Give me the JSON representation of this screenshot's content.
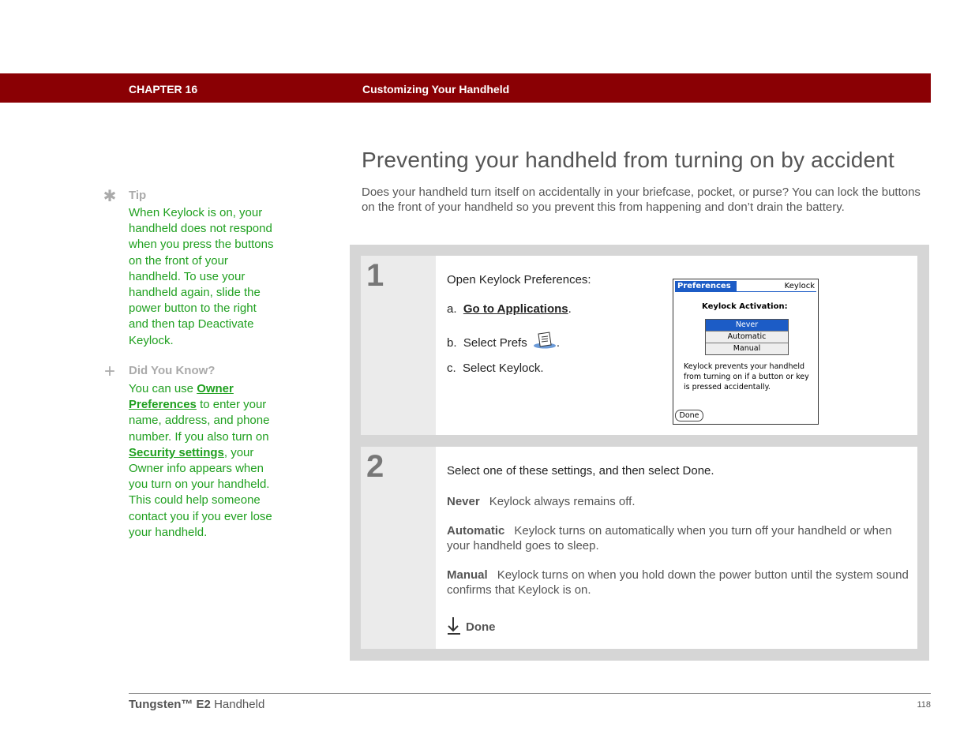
{
  "header": {
    "chapter": "CHAPTER 16",
    "chapter_title": "Customizing Your Handheld",
    "bar_color": "#8a0004"
  },
  "page_title": "Preventing your handheld from turning on by accident",
  "intro": "Does your handheld turn itself on accidentally in your briefcase, pocket, or purse? You can lock the buttons on the front of your handheld so you prevent this from happening and don’t drain the battery.",
  "sidebar": {
    "tip": {
      "icon": "asterisk-icon",
      "heading": "Tip",
      "body": "When Keylock is on, your handheld does not respond when you press the buttons on the front of your handheld. To use your handheld again, slide the power button to the right and then tap Deactivate Keylock."
    },
    "did_you_know": {
      "icon": "plus-icon",
      "heading": "Did You Know?",
      "text_1": "You can use ",
      "link_1": "Owner Preferences",
      "text_2": " to enter your name, address, and phone number. If you also turn on ",
      "link_2": "Security settings",
      "text_3": ", your Owner info appears when you turn on your handheld. This could help someone contact you if you ever lose your handheld."
    },
    "text_color": "#20a020"
  },
  "steps": [
    {
      "number": "1",
      "lead": "Open Keylock Preferences:",
      "items": [
        {
          "marker": "a.",
          "link": "Go to Applications",
          "suffix": "."
        },
        {
          "marker": "b.",
          "text": "Select Prefs",
          "suffix": "."
        },
        {
          "marker": "c.",
          "text": "Select Keylock."
        }
      ],
      "screen": {
        "tab": "Preferences",
        "app": "Keylock",
        "heading": "Keylock Activation:",
        "options": [
          "Never",
          "Automatic",
          "Manual"
        ],
        "selected": "Never",
        "description": "Keylock prevents your handheld from turning on if a button or key is pressed accidentally.",
        "button": "Done"
      }
    },
    {
      "number": "2",
      "lead": "Select one of these settings, and then select Done.",
      "settings": [
        {
          "name": "Never",
          "desc": "Keylock always remains off."
        },
        {
          "name": "Automatic",
          "desc": "Keylock turns on automatically when you turn off your handheld or when your handheld goes to sleep."
        },
        {
          "name": "Manual",
          "desc": "Keylock turns on when you hold down the power button until the system sound confirms that Keylock is on."
        }
      ],
      "done_label": "Done"
    }
  ],
  "footer": {
    "product": "Tungsten™ E2",
    "product_suffix": " Handheld",
    "page": "118"
  }
}
